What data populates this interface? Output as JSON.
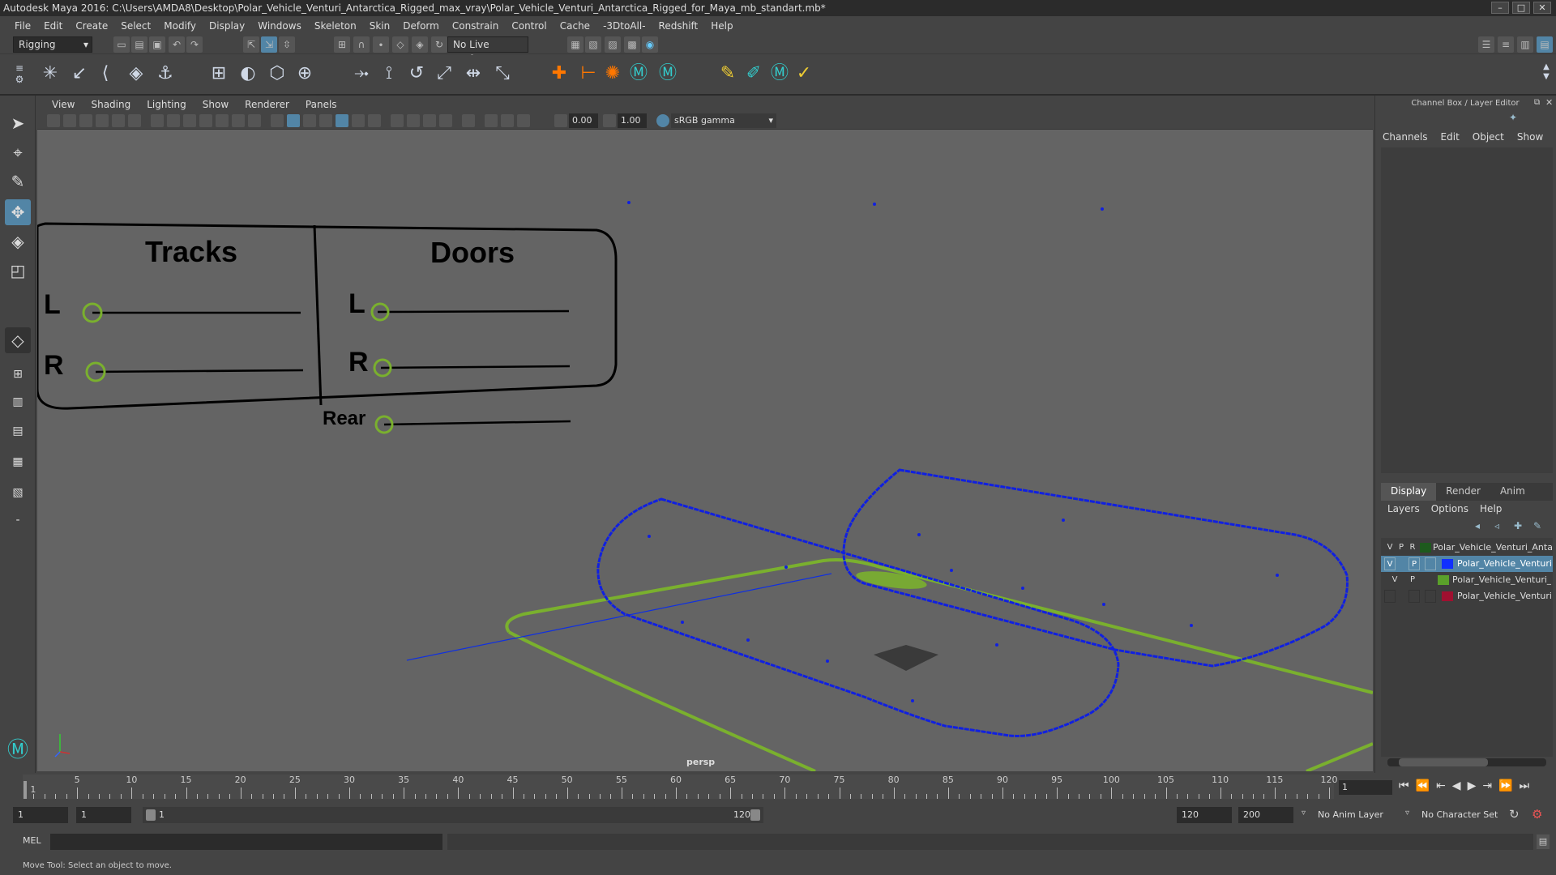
{
  "window": {
    "title": "Autodesk Maya 2016: C:\\Users\\AMDA8\\Desktop\\Polar_Vehicle_Venturi_Antarctica_Rigged_max_vray\\Polar_Vehicle_Venturi_Antarctica_Rigged_for_Maya_mb_standart.mb*",
    "controls": [
      "–",
      "□",
      "✕"
    ]
  },
  "menubar": [
    "File",
    "Edit",
    "Create",
    "Select",
    "Modify",
    "Display",
    "Windows",
    "Skeleton",
    "Skin",
    "Deform",
    "Constrain",
    "Control",
    "Cache",
    "-3DtoAll-",
    "Redshift",
    "Help"
  ],
  "statusline": {
    "mode": "Rigging",
    "live_surface": "No Live Surface"
  },
  "viewport": {
    "menu": [
      "View",
      "Shading",
      "Lighting",
      "Show",
      "Renderer",
      "Panels"
    ],
    "near": "0.00",
    "far": "1.00",
    "color_space": "sRGB gamma",
    "camera": "persp"
  },
  "control_panel": {
    "tracks_title": "Tracks",
    "doors_title": "Doors",
    "tracks_l": "L",
    "tracks_r": "R",
    "doors_l": "L",
    "doors_r": "R",
    "doors_rear": "Rear"
  },
  "channel_box": {
    "title": "Channel Box / Layer Editor",
    "menu": [
      "Channels",
      "Edit",
      "Object",
      "Show"
    ]
  },
  "layer_editor": {
    "tabs": [
      "Display",
      "Render",
      "Anim"
    ],
    "menu": [
      "Layers",
      "Options",
      "Help"
    ],
    "layers": [
      {
        "v": "V",
        "p": "P",
        "r": "R",
        "color": "#1e5a1e",
        "name": "Polar_Vehicle_Venturi_Antarctica"
      },
      {
        "v": "V",
        "p": "P",
        "r": "",
        "color": "#1030ff",
        "name": "Polar_Vehicle_Venturi_"
      },
      {
        "v": "V",
        "p": "P",
        "r": "",
        "color": "#5aa02a",
        "name": "Polar_Vehicle_Venturi_A"
      },
      {
        "v": "",
        "p": "",
        "r": "",
        "color": "#a01030",
        "name": "Polar_Vehicle_Venturi_"
      }
    ]
  },
  "timeline": {
    "labels": [
      "5",
      "10",
      "15",
      "20",
      "25",
      "30",
      "35",
      "40",
      "45",
      "50",
      "55",
      "60",
      "65",
      "70",
      "75",
      "80",
      "85",
      "90",
      "95",
      "100",
      "105",
      "110",
      "115",
      "120"
    ],
    "first_label": "1",
    "current_frame": "1"
  },
  "range": {
    "start": "1",
    "current": "1",
    "slider_start": "1",
    "slider_end": "120",
    "end": "120",
    "anim_end": "200",
    "anim_layer": "No Anim Layer",
    "character_set": "No Character Set"
  },
  "command_line": {
    "label": "MEL"
  },
  "help_line": "Move Tool: Select an object to move.",
  "colors": {
    "rig_blue": "#1020e0",
    "ground_green": "#7ab02e",
    "control_circle": "#7ab02e",
    "selection": "#5285a6"
  }
}
